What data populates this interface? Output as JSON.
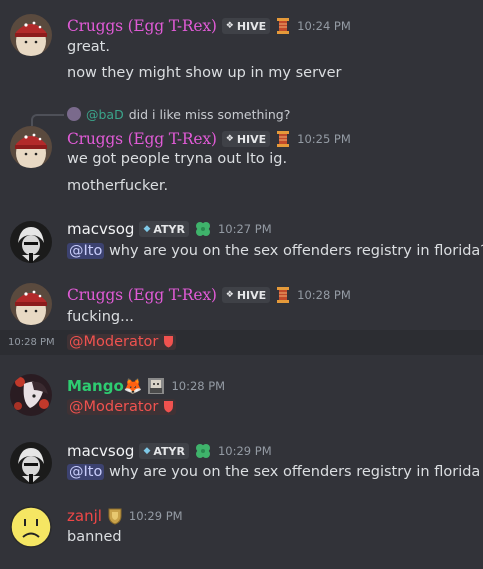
{
  "messages": [
    {
      "id": "m1",
      "author": "Cruggs (Egg T-Rex)",
      "tag": "HIVE",
      "time": "10:24 PM",
      "lines": [
        "great.",
        "now they might show up in my server"
      ]
    },
    {
      "id": "m2",
      "reply": {
        "user": "@baD",
        "text": "did i like miss something?"
      },
      "author": "Cruggs (Egg T-Rex)",
      "tag": "HIVE",
      "time": "10:25 PM",
      "lines": [
        "we got people tryna out Ito ig.",
        "motherfucker."
      ]
    },
    {
      "id": "m3",
      "author": "macvsog",
      "tag": "ATYR",
      "time": "10:27 PM",
      "mention": "@Ito",
      "text": " why are you on the sex offenders registry in florida?"
    },
    {
      "id": "m4",
      "author": "Cruggs (Egg T-Rex)",
      "tag": "HIVE",
      "time": "10:28 PM",
      "lines": [
        "fucking..."
      ],
      "followup": {
        "time": "10:28 PM",
        "role": "@Moderator"
      }
    },
    {
      "id": "m5",
      "author": "Mango🦊",
      "time": "10:28 PM",
      "role": "@Moderator"
    },
    {
      "id": "m6",
      "author": "macvsog",
      "tag": "ATYR",
      "time": "10:29 PM",
      "mention": "@Ito",
      "text": " why are you on the sex offenders registry in florida"
    },
    {
      "id": "m7",
      "author": "zanjl",
      "time": "10:29 PM",
      "lines": [
        "banned"
      ]
    }
  ],
  "icons": {
    "tag": "four-diamond-icon",
    "badge_spool": "spool-icon",
    "badge_clover": "clover-icon",
    "badge_shield": "shield-badge-icon",
    "role_shield": "shield-icon"
  },
  "colors": {
    "background": "#323339",
    "cruggs": "#e05bd6",
    "mango": "#2ecc71",
    "zanjl": "#f04747",
    "mention_bg": "#3c4270",
    "role": "#f0524f"
  }
}
